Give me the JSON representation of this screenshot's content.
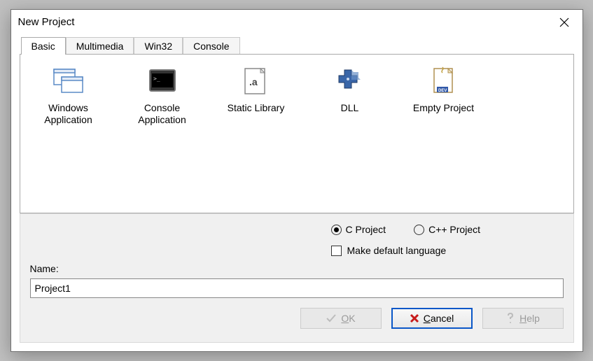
{
  "dialog": {
    "title": "New Project"
  },
  "tabs": {
    "active": "Basic",
    "items": [
      "Basic",
      "Multimedia",
      "Win32",
      "Console"
    ]
  },
  "templates": [
    {
      "id": "windows-app",
      "label": "Windows Application",
      "icon": "windows-app-icon"
    },
    {
      "id": "console-app",
      "label": "Console Application",
      "icon": "console-app-icon"
    },
    {
      "id": "static-lib",
      "label": "Static Library",
      "icon": "static-lib-icon"
    },
    {
      "id": "dll",
      "label": "DLL",
      "icon": "dll-icon"
    },
    {
      "id": "empty",
      "label": "Empty Project",
      "icon": "empty-project-icon"
    }
  ],
  "language": {
    "options": {
      "c": "C Project",
      "cpp": "C++ Project"
    },
    "selected": "c",
    "default_checkbox_label": "Make default language",
    "default_checked": false
  },
  "name": {
    "label": "Name:",
    "value": "Project1"
  },
  "buttons": {
    "ok": "OK",
    "cancel": "Cancel",
    "help": "Help"
  }
}
